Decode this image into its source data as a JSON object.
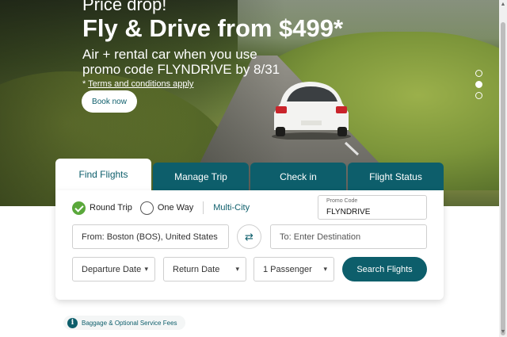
{
  "hero": {
    "kicker": "Price drop!",
    "headline": "Fly & Drive from $499*",
    "subline": "Air + rental car when you use promo code FLYNDRIVE by 8/31",
    "terms_prefix": "* ",
    "terms_link": "Terms and conditions apply",
    "cta": "Book now",
    "slides": 3,
    "active_slide": 2
  },
  "tabs": [
    {
      "label": "Find Flights",
      "active": true
    },
    {
      "label": "Manage Trip",
      "active": false
    },
    {
      "label": "Check in",
      "active": false
    },
    {
      "label": "Flight Status",
      "active": false
    }
  ],
  "booking": {
    "trip_types": [
      {
        "label": "Round Trip",
        "checked": true
      },
      {
        "label": "One Way",
        "checked": false
      }
    ],
    "multi_city": "Multi-City",
    "promo": {
      "label": "Promo Code",
      "value": "FLYNDRIVE"
    },
    "from": {
      "label": "From:",
      "value": "Boston (BOS), United States"
    },
    "to": {
      "placeholder": "To: Enter Destination"
    },
    "swap_icon": "swap-arrows-icon",
    "departure": "Departure Date",
    "return": "Return Date",
    "passengers": "1 Passenger",
    "search": "Search Flights"
  },
  "footer": {
    "baggage": "Baggage & Optional Service Fees"
  },
  "colors": {
    "brand": "#0d5e6b",
    "check": "#5aa83b"
  }
}
